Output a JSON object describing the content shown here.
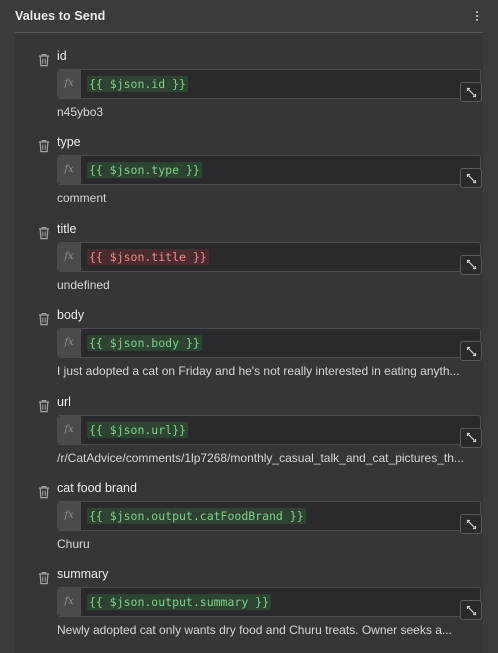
{
  "header": {
    "title": "Values to Send"
  },
  "fields": [
    {
      "label": "id",
      "expression": "{{ $json.id }}",
      "valid": true,
      "result": "n45ybo3"
    },
    {
      "label": "type",
      "expression": "{{ $json.type }}",
      "valid": true,
      "result": "comment"
    },
    {
      "label": "title",
      "expression": "{{ $json.title }}",
      "valid": false,
      "result": "undefined"
    },
    {
      "label": "body",
      "expression": "{{ $json.body }}",
      "valid": true,
      "result": "I just adopted a cat on Friday and he's not really interested in eating anyth..."
    },
    {
      "label": "url",
      "expression": "{{ $json.url}}",
      "valid": true,
      "result": "/r/CatAdvice/comments/1lp7268/monthly_casual_talk_and_cat_pictures_th..."
    },
    {
      "label": "cat food brand",
      "expression": "{{ $json.output.catFoodBrand }}",
      "valid": true,
      "result": "Churu"
    },
    {
      "label": "summary",
      "expression": "{{ $json.output.summary }}",
      "valid": true,
      "result": "Newly adopted cat only wants dry food and Churu treats. Owner seeks a..."
    }
  ],
  "fx_label": "fx",
  "icons": {
    "menu": "kebab-menu-icon",
    "delete": "trash-icon",
    "expand": "open-expression-editor-icon"
  },
  "colors": {
    "background": "#3b3b3d",
    "valid_expression": "#7fd18b",
    "invalid_expression": "#f08b8b"
  }
}
